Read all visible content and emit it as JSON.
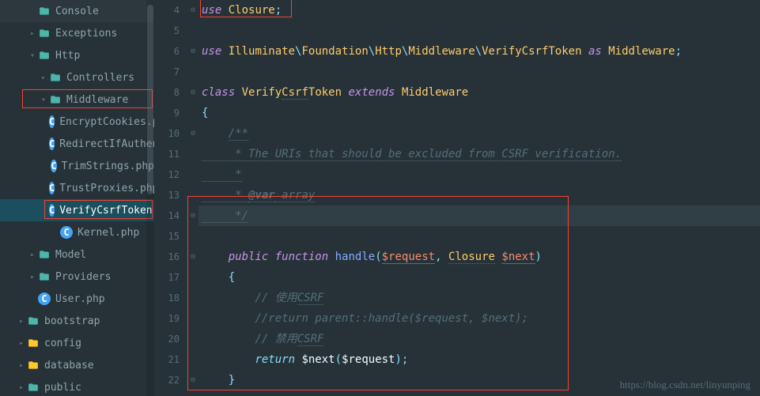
{
  "sidebar": {
    "items": [
      {
        "label": "Console",
        "type": "folder",
        "level": 2,
        "nomark": true
      },
      {
        "label": "Exceptions",
        "type": "folder",
        "level": 2,
        "arrow": ">"
      },
      {
        "label": "Http",
        "type": "folder-open",
        "level": 2,
        "arrow": "v"
      },
      {
        "label": "Controllers",
        "type": "folder",
        "level": 3,
        "arrow": ">"
      },
      {
        "label": "Middleware",
        "type": "folder-open",
        "level": 3,
        "arrow": "v",
        "redbox": true
      },
      {
        "label": "EncryptCookies.php",
        "type": "file",
        "level": 5
      },
      {
        "label": "RedirectIfAuthenticated.php",
        "type": "file",
        "level": 5
      },
      {
        "label": "TrimStrings.php",
        "type": "file",
        "level": 5
      },
      {
        "label": "TrustProxies.php",
        "type": "file",
        "level": 5
      },
      {
        "label": "VerifyCsrfToken.php",
        "type": "file",
        "level": 5,
        "redbox": true,
        "selected": true
      },
      {
        "label": "Kernel.php",
        "type": "file",
        "level": 4
      },
      {
        "label": "Model",
        "type": "folder",
        "level": 2,
        "arrow": ">"
      },
      {
        "label": "Providers",
        "type": "folder",
        "level": 2,
        "arrow": ">"
      },
      {
        "label": "User.php",
        "type": "file",
        "level": 2
      },
      {
        "label": "bootstrap",
        "type": "folder",
        "level": 1,
        "arrow": ">"
      },
      {
        "label": "config",
        "type": "special",
        "level": 1,
        "arrow": ">"
      },
      {
        "label": "database",
        "type": "special",
        "level": 1,
        "arrow": ">"
      },
      {
        "label": "public",
        "type": "folder",
        "level": 1,
        "arrow": ">"
      }
    ]
  },
  "code": {
    "lines": [
      {
        "n": 4,
        "html": "<span class='kw2'>use</span> <span class='cls'>Closure</span><span class='punct'>;</span>"
      },
      {
        "n": 5,
        "html": ""
      },
      {
        "n": 6,
        "html": "<span class='kw2'>use</span> <span class='cls'>Illuminate</span><span class='punct'>\\</span><span class='cls'>Foundation</span><span class='punct'>\\</span><span class='cls'>Http</span><span class='punct'>\\</span><span class='cls'>Middleware</span><span class='punct'>\\</span><span class='cls'>VerifyCsrfToken</span> <span class='kw2'>as</span> <span class='cls'>Middleware</span><span class='punct'>;</span>"
      },
      {
        "n": 7,
        "html": ""
      },
      {
        "n": 8,
        "html": "<span class='kw2'>class</span> <span class='cls'>Verify<span class='underl'>Csrf</span>Token</span> <span class='kw2'>extends</span> <span class='cls'>Middleware</span>"
      },
      {
        "n": 9,
        "html": "<span class='punct'>{</span>"
      },
      {
        "n": 10,
        "html": "    <span class='docblock'>/**</span>"
      },
      {
        "n": 11,
        "html": "<span class='docblock'>     * The URIs that should be excluded from CSRF verification.</span>"
      },
      {
        "n": 12,
        "html": "<span class='docblock'>     *</span>"
      },
      {
        "n": 13,
        "html": "<span class='docblock'>     * </span><span class='doctag'>@var</span><span class='docblock'> array</span>"
      },
      {
        "n": 14,
        "html": "<span class='docblock'>     */</span>",
        "hl": true
      },
      {
        "n": 15,
        "html": ""
      },
      {
        "n": 16,
        "html": "    <span class='kw2'>public</span> <span class='kw2'>function</span> <span class='fn'>handle</span><span class='punct'>(</span><span class='param'>$request</span><span class='punct'>,</span> <span class='cls underl'>Closure</span> <span class='param'>$next</span><span class='punct'>)</span>"
      },
      {
        "n": 17,
        "html": "    <span class='punct'>{</span>"
      },
      {
        "n": 18,
        "html": "        <span class='comment'>// 使用<span class='underl'>CSRF</span></span>"
      },
      {
        "n": 19,
        "html": "        <span class='comment'>//return parent::handle($request, $next);</span>"
      },
      {
        "n": 20,
        "html": "        <span class='comment'>// 禁用<span class='underl'>CSRF</span></span>"
      },
      {
        "n": 21,
        "html": "        <span class='return'>return</span> <span class='var'>$next</span><span class='punct'>(</span><span class='var'>$request</span><span class='punct'>);</span>"
      },
      {
        "n": 22,
        "html": "    <span class='punct'>}</span>"
      }
    ]
  },
  "fold": {
    "marks": {
      "4": "⊟",
      "6": "⊟",
      "8": "⊟",
      "10": "⊟",
      "14": "⊟",
      "16": "⊟",
      "22": "⊟"
    }
  },
  "watermark": "https://blog.csdn.net/linyunping"
}
